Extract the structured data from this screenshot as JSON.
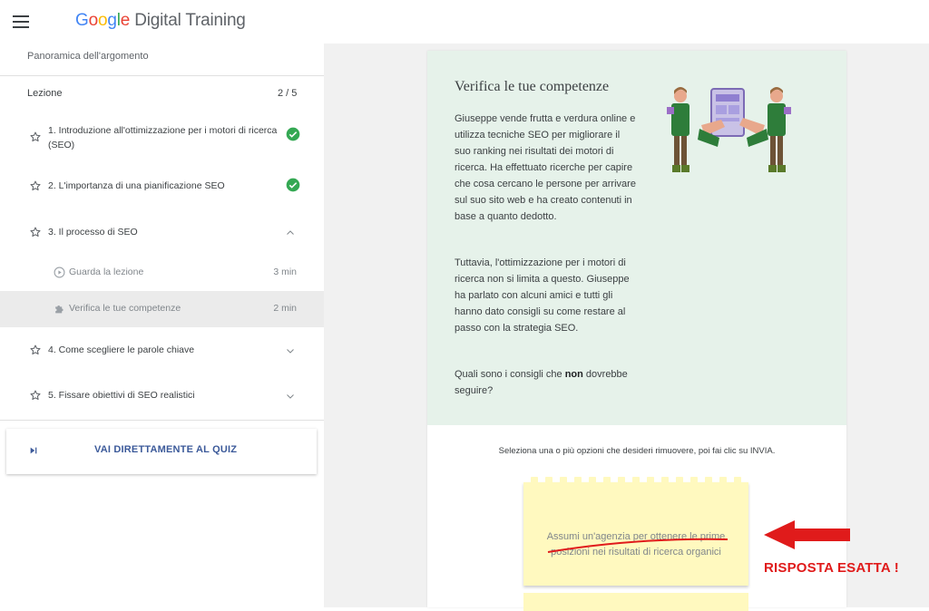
{
  "header": {
    "logo_google": [
      "G",
      "o",
      "o",
      "g",
      "l",
      "e"
    ],
    "logo_rest": " Digital Training"
  },
  "sidebar": {
    "overview": "Panoramica dell'argomento",
    "lesson_heading": "Lezione",
    "lesson_count": "2 / 5",
    "items": [
      {
        "label": "1. Introduzione all'ottimizzazione per i motori di ricerca (SEO)",
        "status": "completed"
      },
      {
        "label": "2. L'importanza di una pianificazione SEO",
        "status": "completed"
      },
      {
        "label": "3. Il processo di SEO",
        "status": "expanded"
      },
      {
        "label": "4. Come scegliere le parole chiave",
        "status": "collapsed"
      },
      {
        "label": "5. Fissare obiettivi di SEO realistici",
        "status": "collapsed"
      }
    ],
    "subitems": [
      {
        "label": "Guarda la lezione",
        "time": "3 min",
        "icon": "play-icon"
      },
      {
        "label": "Verifica le tue competenze",
        "time": "2 min",
        "icon": "puzzle-icon"
      }
    ],
    "quiz_button": "VAI DIRETTAMENTE AL QUIZ"
  },
  "main": {
    "title": "Verifica le tue competenze",
    "paragraph1": "Giuseppe vende frutta e verdura online e utilizza tecniche SEO per migliorare il suo ranking nei risultati dei motori di ricerca. Ha effettuato ricerche per capire che cosa cercano le persone per arrivare sul suo sito web e ha creato contenuti in base a quanto dedotto.",
    "paragraph2": "Tuttavia, l'ottimizzazione per i motori di ricerca non si limita a questo. Giuseppe ha parlato con alcuni amici e tutti gli hanno dato consigli su come restare al passo con la strategia SEO.",
    "question_pre": "Quali sono i consigli che ",
    "question_bold": "non",
    "question_post": " dovrebbe seguire?",
    "instruction": "Seleziona una o più opzioni che desideri rimuovere, poi fai clic su INVIA.",
    "option1": "Assumi un'agenzia per ottenere le prime posizioni nei risultati di ricerca organici"
  },
  "annotation": {
    "label": "RISPOSTA ESATTA !",
    "color": "#e01b1b"
  },
  "colors": {
    "check_green": "#34a853",
    "card_top": "#e6f2ea",
    "sticky_note": "#fff9bf",
    "quiz_blue": "#3c5a9a"
  }
}
